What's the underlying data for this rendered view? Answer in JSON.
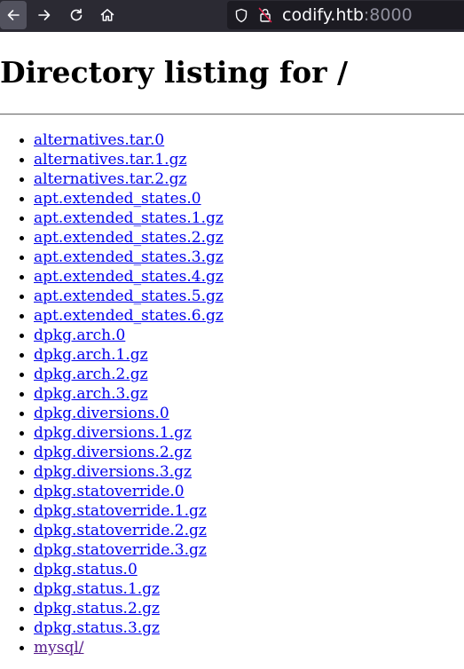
{
  "browser": {
    "url_host": "codify.htb",
    "url_port": ":8000",
    "icons": [
      "back-arrow-icon",
      "forward-arrow-icon",
      "reload-icon",
      "home-icon",
      "shield-icon",
      "insecure-lock-icon"
    ]
  },
  "page": {
    "title": "Directory listing for /",
    "link_color": "#0000ee",
    "visited_link_color": "#551a8b",
    "files": [
      {
        "name": "alternatives.tar.0"
      },
      {
        "name": "alternatives.tar.1.gz"
      },
      {
        "name": "alternatives.tar.2.gz"
      },
      {
        "name": "apt.extended_states.0"
      },
      {
        "name": "apt.extended_states.1.gz"
      },
      {
        "name": "apt.extended_states.2.gz"
      },
      {
        "name": "apt.extended_states.3.gz"
      },
      {
        "name": "apt.extended_states.4.gz"
      },
      {
        "name": "apt.extended_states.5.gz"
      },
      {
        "name": "apt.extended_states.6.gz"
      },
      {
        "name": "dpkg.arch.0"
      },
      {
        "name": "dpkg.arch.1.gz"
      },
      {
        "name": "dpkg.arch.2.gz"
      },
      {
        "name": "dpkg.arch.3.gz"
      },
      {
        "name": "dpkg.diversions.0"
      },
      {
        "name": "dpkg.diversions.1.gz"
      },
      {
        "name": "dpkg.diversions.2.gz"
      },
      {
        "name": "dpkg.diversions.3.gz"
      },
      {
        "name": "dpkg.statoverride.0"
      },
      {
        "name": "dpkg.statoverride.1.gz"
      },
      {
        "name": "dpkg.statoverride.2.gz"
      },
      {
        "name": "dpkg.statoverride.3.gz"
      },
      {
        "name": "dpkg.status.0"
      },
      {
        "name": "dpkg.status.1.gz"
      },
      {
        "name": "dpkg.status.2.gz"
      },
      {
        "name": "dpkg.status.3.gz"
      },
      {
        "name": "mysql/",
        "visited": true
      }
    ]
  }
}
